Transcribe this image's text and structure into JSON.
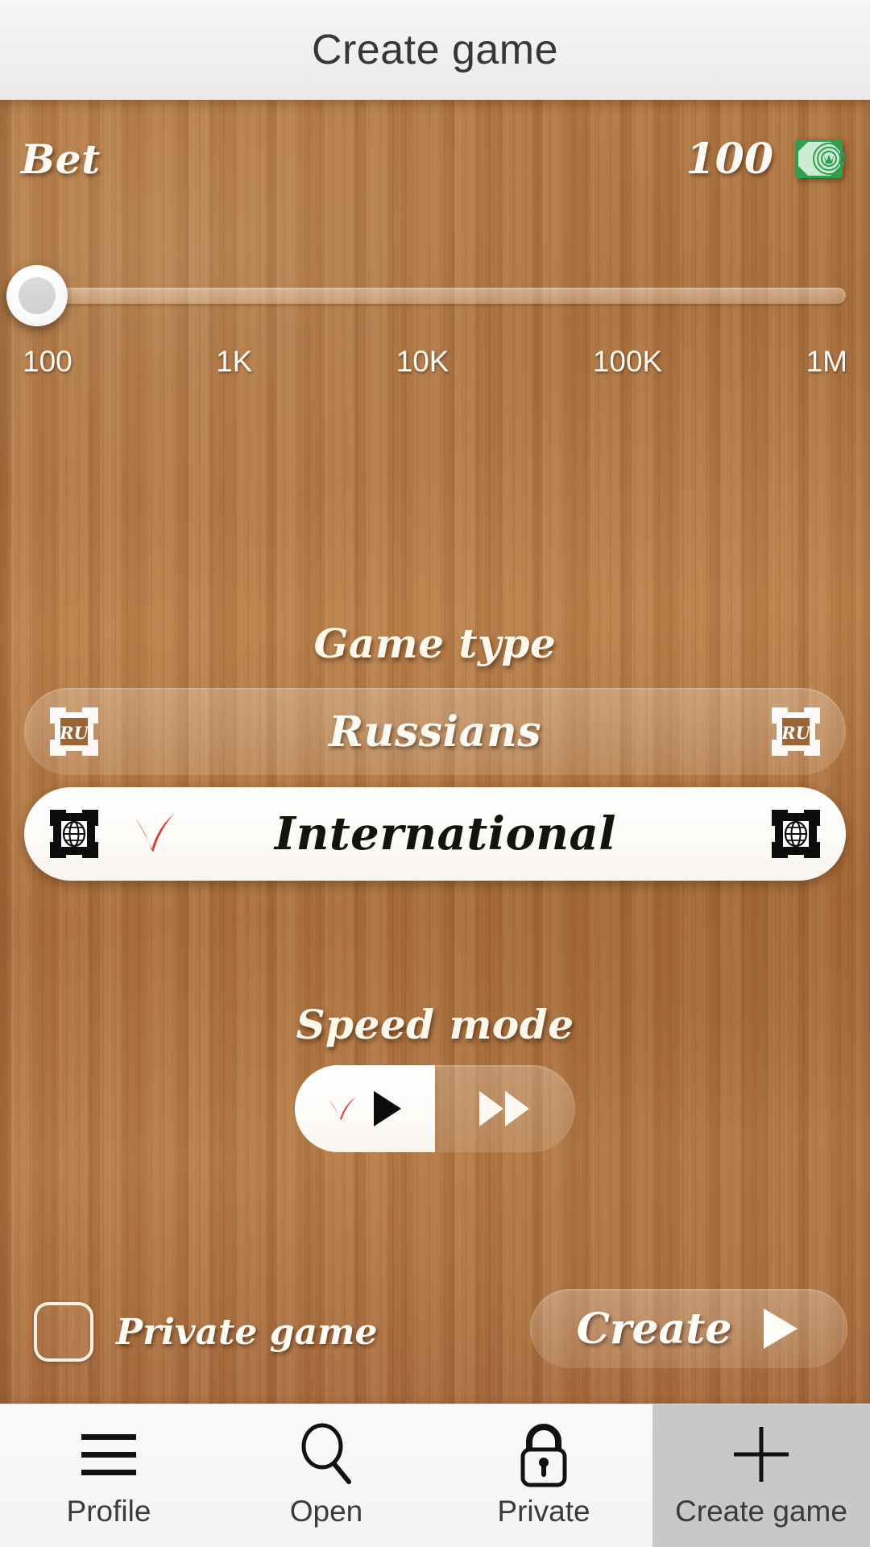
{
  "header": {
    "title": "Create game"
  },
  "bet": {
    "label": "Bet",
    "value": "100",
    "money_icon": "banknote-icon",
    "slider": {
      "knob_position_percent": 0,
      "ticks": [
        "100",
        "1K",
        "10K",
        "100K",
        "1M"
      ]
    }
  },
  "game_type": {
    "heading": "Game type",
    "options": [
      {
        "label": "Russians",
        "selected": false,
        "icon": "ru-board-icon",
        "icon_text": "RU"
      },
      {
        "label": "International",
        "selected": true,
        "icon": "globe-board-icon"
      }
    ]
  },
  "speed_mode": {
    "heading": "Speed mode",
    "options": [
      {
        "icon": "play-icon",
        "selected": true
      },
      {
        "icon": "fast-forward-icon",
        "selected": false
      }
    ]
  },
  "private_game": {
    "label": "Private game",
    "checked": false,
    "checkbox_icon": "checkbox-unchecked-icon"
  },
  "create": {
    "label": "Create",
    "arrow_icon": "play-arrow-icon"
  },
  "bottom_nav": {
    "items": [
      {
        "label": "Profile",
        "icon": "menu-icon",
        "active": false
      },
      {
        "label": "Open",
        "icon": "search-icon",
        "active": false
      },
      {
        "label": "Private",
        "icon": "lock-icon",
        "active": false
      },
      {
        "label": "Create game",
        "icon": "plus-icon",
        "active": true
      }
    ]
  },
  "colors": {
    "wood": "#a9703f",
    "accent_check": "#e03a34",
    "money_green": "#2e9e4f",
    "header_bg": "#efefed",
    "nav_active_bg": "#c8c8c8"
  }
}
